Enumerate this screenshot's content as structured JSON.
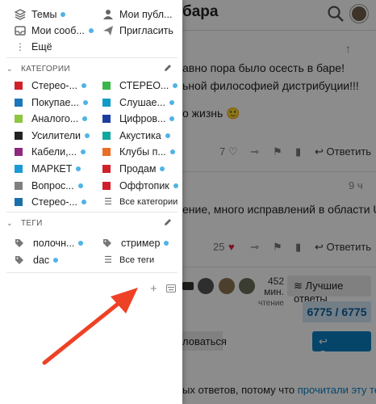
{
  "background": {
    "title": "бара",
    "post1_line1": "авно пора было осесть в баре!",
    "post1_line2": "ьной философией дистрибуции!!!",
    "post1_line3": "о жизнь 🙂",
    "post1_likes": "7",
    "reply_label": "Ответить",
    "post2_age": "9 ч",
    "post2_line1": "ение, много исправлений в области UX",
    "post2_likes": "25",
    "read_time_value": "452 мин.",
    "read_time_label": "чтение",
    "best_answers_label": "Лучшие ответы",
    "progress": "6775 / 6775",
    "follow_label": "ловаться",
    "reply_button_label": "Ответить",
    "bottom_note_prefix": "ых ответов, потому что ",
    "bottom_note_link1": "прочитали",
    "bottom_note_link2": "эту тему",
    "bottom_note_suffix": "."
  },
  "drawer": {
    "top_items": [
      {
        "label": "Темы",
        "icon": "layers-icon",
        "dot": true
      },
      {
        "label": "Мои публ...",
        "icon": "user-icon",
        "dot": false
      },
      {
        "label": "Мои сооб...",
        "icon": "inbox-icon",
        "dot": true
      },
      {
        "label": "Пригласить",
        "icon": "paper-plane-icon",
        "dot": false
      },
      {
        "label": "Ещё",
        "icon": "more-icon",
        "dot": false
      }
    ],
    "categories_title": "КАТЕГОРИИ",
    "categories": [
      {
        "label": "Стерео-...",
        "color": "#d0202a",
        "dot": true
      },
      {
        "label": "СТЕРЕО...",
        "color": "#3ab54a",
        "dot": true
      },
      {
        "label": "Покупае...",
        "color": "#1b76bb",
        "dot": true
      },
      {
        "label": "Слушае...",
        "color": "#0e9bc9",
        "dot": true
      },
      {
        "label": "Аналого...",
        "color": "#8dc63f",
        "dot": true
      },
      {
        "label": "Цифров...",
        "color": "#1d3da0",
        "dot": true
      },
      {
        "label": "Усилители",
        "color": "#222222",
        "dot": true
      },
      {
        "label": "Акустика",
        "color": "#12a89d",
        "dot": true
      },
      {
        "label": "Кабели,...",
        "color": "#8e2a7e",
        "dot": true
      },
      {
        "label": "Клубы п...",
        "color": "#ec6d24",
        "dot": true
      },
      {
        "label": "МАРКЕТ",
        "color": "#1a9ad6",
        "dot": true
      },
      {
        "label": "Продам",
        "color": "#d0202a",
        "dot": true
      },
      {
        "label": "Вопрос...",
        "color": "#808080",
        "dot": true
      },
      {
        "label": "Оффтопик",
        "color": "#d0202a",
        "dot": true
      },
      {
        "label": "Стерео-...",
        "color": "#1b6fa8",
        "dot": true
      },
      {
        "label": "Все категории",
        "color": "",
        "dot": false
      }
    ],
    "tags_title": "ТЕГИ",
    "tags": [
      {
        "label": "полочн...",
        "dot": true
      },
      {
        "label": "стример",
        "dot": true
      },
      {
        "label": "dac",
        "dot": true
      },
      {
        "label": "Все теги",
        "dot": false
      }
    ]
  },
  "colors": {
    "accent": "#0a7fc1",
    "unread_dot": "#4fb3e6",
    "annotation_arrow": "#ee4125"
  }
}
